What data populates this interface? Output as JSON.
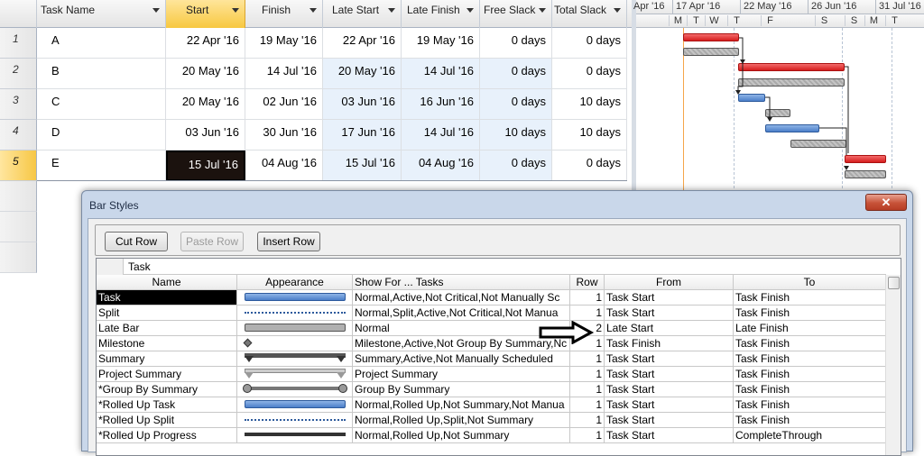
{
  "sheet": {
    "columns": [
      {
        "label": "Task Name"
      },
      {
        "label": "Start"
      },
      {
        "label": "Finish"
      },
      {
        "label": "Late Start"
      },
      {
        "label": "Late Finish"
      },
      {
        "label": "Free Slack"
      },
      {
        "label": "Total Slack"
      }
    ],
    "rows": [
      {
        "id": "1",
        "name": "A",
        "start": "22 Apr '16",
        "finish": "19 May '16",
        "late_start": "22 Apr '16",
        "late_finish": "19 May '16",
        "free_slack": "0 days",
        "total_slack": "0 days"
      },
      {
        "id": "2",
        "name": "B",
        "start": "20 May '16",
        "finish": "14 Jul '16",
        "late_start": "20 May '16",
        "late_finish": "14 Jul '16",
        "free_slack": "0 days",
        "total_slack": "0 days"
      },
      {
        "id": "3",
        "name": "C",
        "start": "20 May '16",
        "finish": "02 Jun '16",
        "late_start": "03 Jun '16",
        "late_finish": "16 Jun '16",
        "free_slack": "0 days",
        "total_slack": "10 days"
      },
      {
        "id": "4",
        "name": "D",
        "start": "03 Jun '16",
        "finish": "30 Jun '16",
        "late_start": "17 Jun '16",
        "late_finish": "14 Jul '16",
        "free_slack": "10 days",
        "total_slack": "10 days"
      },
      {
        "id": "5",
        "name": "E",
        "start": "15 Jul '16",
        "finish": "04 Aug '16",
        "late_start": "15 Jul '16",
        "late_finish": "04 Aug '16",
        "free_slack": "0 days",
        "total_slack": "0 days"
      }
    ]
  },
  "gantt": {
    "weeks": [
      "Apr '16",
      "17 Apr '16",
      "22 May '16",
      "26 Jun '16",
      "31 Jul '16"
    ],
    "days": [
      "M",
      "T",
      "W",
      "T",
      "F",
      "S",
      "S",
      "M",
      "T"
    ]
  },
  "dialog": {
    "title": "Bar Styles",
    "close_glyph": "✕",
    "buttons": {
      "cut": "Cut Row",
      "paste": "Paste Row",
      "insert": "Insert Row"
    },
    "edit_value": "Task",
    "headers": [
      "Name",
      "Appearance",
      "Show For ... Tasks",
      "Row",
      "From",
      "To"
    ],
    "rows": [
      {
        "name": "Task",
        "show": "Normal,Active,Not Critical,Not Manually Sc",
        "row": "1",
        "from": "Task Start",
        "to": "Task Finish",
        "ap": "task"
      },
      {
        "name": "Split",
        "show": "Normal,Split,Active,Not Critical,Not Manua",
        "row": "1",
        "from": "Task Start",
        "to": "Task Finish",
        "ap": "split"
      },
      {
        "name": "Late Bar",
        "show": "Normal",
        "row": "2",
        "from": "Late Start",
        "to": "Late Finish",
        "ap": "late"
      },
      {
        "name": "Milestone",
        "show": "Milestone,Active,Not Group By Summary,Nc",
        "row": "1",
        "from": "Task Finish",
        "to": "Task Finish",
        "ap": "milestone"
      },
      {
        "name": "Summary",
        "show": "Summary,Active,Not Manually Scheduled",
        "row": "1",
        "from": "Task Start",
        "to": "Task Finish",
        "ap": "summary"
      },
      {
        "name": "Project Summary",
        "show": "Project Summary",
        "row": "1",
        "from": "Task Start",
        "to": "Task Finish",
        "ap": "project"
      },
      {
        "name": "*Group By Summary",
        "show": "Group By Summary",
        "row": "1",
        "from": "Task Start",
        "to": "Task Finish",
        "ap": "group"
      },
      {
        "name": "*Rolled Up Task",
        "show": "Normal,Rolled Up,Not Summary,Not Manua",
        "row": "1",
        "from": "Task Start",
        "to": "Task Finish",
        "ap": "task"
      },
      {
        "name": "*Rolled Up Split",
        "show": "Normal,Rolled Up,Split,Not Summary",
        "row": "1",
        "from": "Task Start",
        "to": "Task Finish",
        "ap": "split"
      },
      {
        "name": "*Rolled Up Progress",
        "show": "Normal,Rolled Up,Not Summary",
        "row": "1",
        "from": "Task Start",
        "to": "CompleteThrough",
        "ap": "progress"
      }
    ]
  },
  "colors": {
    "task_blue": "#4b7fc9",
    "critical_red": "#d51d1d",
    "late_gray": "#aaaaaa",
    "selected_yellow": "#f7c840"
  }
}
